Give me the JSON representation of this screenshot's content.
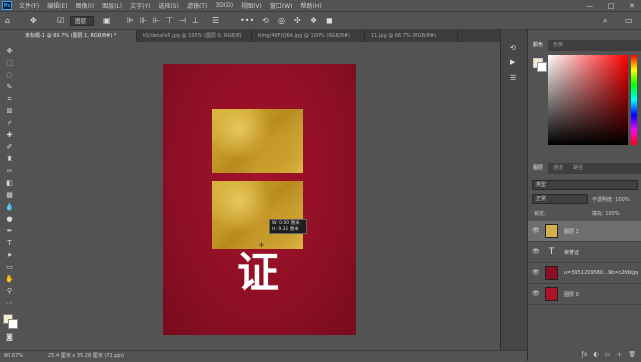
{
  "menubar": {
    "logo": "Ps",
    "items": [
      "文件(F)",
      "编辑(E)",
      "图像(I)",
      "图层(L)",
      "文字(Y)",
      "选择(S)",
      "滤镜(T)",
      "3D(D)",
      "视图(V)",
      "窗口(W)",
      "帮助(H)"
    ],
    "window_controls": [
      "—",
      "□",
      "✕"
    ]
  },
  "options": {
    "auto_select_label": "图层",
    "more_label": "•••"
  },
  "tabs": [
    "未标题-1 @ 80.7% (图层 1, RGB/8#) *",
    "k5/details5.jpg @ 195% (图层 0, RGB/8)",
    "timg(46F)Q6A.jpg @ 100% (RGB/8#)",
    "11.jpg @ 66.7% (RGB/8#)"
  ],
  "measure": {
    "w": "W: 0.00 厘米",
    "h": "H: 9.31 厘米"
  },
  "document": {
    "big_char": "证"
  },
  "status": {
    "zoom": "80.67%",
    "doc_info": "25.4 厘米 x 35.28 厘米 (72 ppi)"
  },
  "panels": {
    "color_tabs": [
      "颜色",
      "色板"
    ],
    "layers_tabs": [
      "图层",
      "通道",
      "路径"
    ],
    "filter_kind": "类型",
    "blend_mode": "正常",
    "opacity_label": "不透明度: 100%",
    "lock_label": "锁定:",
    "fill_label": "填充: 100%",
    "layers": [
      {
        "name": "图层 1",
        "selected": true,
        "thumb": "#d4b04a"
      },
      {
        "name": "荣誉证",
        "selected": false,
        "thumb": "T"
      },
      {
        "name": "u=3951209580...9b=c2fdkjpg.jpg 8",
        "selected": false,
        "thumb": "#8e0f25"
      },
      {
        "name": "图层 0",
        "selected": false,
        "thumb": "#b0112a"
      }
    ],
    "bottom_icons": [
      "ƒx",
      "◐",
      "▭",
      "＋",
      "🗑"
    ]
  },
  "colors": {
    "document_red": "#8e0f25",
    "gold": "#d9b53f"
  }
}
